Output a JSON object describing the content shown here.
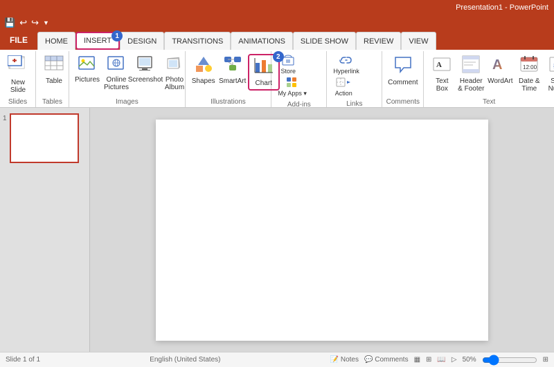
{
  "titleBar": {
    "text": "Presentation1 - PowerPoint"
  },
  "quickAccess": {
    "icons": [
      "💾",
      "↩",
      "↪"
    ]
  },
  "tabs": [
    {
      "id": "file",
      "label": "FILE",
      "type": "file"
    },
    {
      "id": "home",
      "label": "HOME"
    },
    {
      "id": "insert",
      "label": "INSERT",
      "active": true,
      "highlighted": true
    },
    {
      "id": "design",
      "label": "DESIGN"
    },
    {
      "id": "transitions",
      "label": "TRANSITIONS"
    },
    {
      "id": "animations",
      "label": "ANIMATIONS"
    },
    {
      "id": "slideshow",
      "label": "SLIDE SHOW"
    },
    {
      "id": "review",
      "label": "REVIEW"
    },
    {
      "id": "view",
      "label": "VIEW"
    }
  ],
  "ribbon": {
    "groups": [
      {
        "id": "slides",
        "label": "Slides",
        "buttons": [
          {
            "id": "new-slide",
            "label": "New\nSlide",
            "icon": "slide",
            "size": "large"
          }
        ]
      },
      {
        "id": "tables",
        "label": "Tables",
        "buttons": [
          {
            "id": "table",
            "label": "Table",
            "icon": "table",
            "size": "large"
          }
        ]
      },
      {
        "id": "images",
        "label": "Images",
        "buttons": [
          {
            "id": "pictures",
            "label": "Pictures",
            "icon": "picture"
          },
          {
            "id": "online-pictures",
            "label": "Online\nPictures",
            "icon": "online-pic"
          },
          {
            "id": "screenshot",
            "label": "Screenshot",
            "icon": "screenshot"
          },
          {
            "id": "photo-album",
            "label": "Photo\nAlbum",
            "icon": "album"
          }
        ]
      },
      {
        "id": "illustrations",
        "label": "Illustrations",
        "buttons": [
          {
            "id": "shapes",
            "label": "Shapes",
            "icon": "shapes"
          },
          {
            "id": "smartart",
            "label": "SmartArt",
            "icon": "smartart"
          },
          {
            "id": "chart",
            "label": "Chart",
            "icon": "chart",
            "highlighted": true
          }
        ]
      },
      {
        "id": "addins",
        "label": "Add-ins",
        "buttons": [
          {
            "id": "store",
            "label": "Store",
            "icon": "store"
          },
          {
            "id": "myapps",
            "label": "My Apps",
            "icon": "apps"
          }
        ]
      },
      {
        "id": "links",
        "label": "Links",
        "buttons": [
          {
            "id": "hyperlink",
            "label": "Hyperlink",
            "icon": "hyperlink"
          },
          {
            "id": "action",
            "label": "Action",
            "icon": "action"
          }
        ]
      },
      {
        "id": "comments",
        "label": "Comments",
        "buttons": [
          {
            "id": "comment",
            "label": "Comment",
            "icon": "comment"
          }
        ]
      },
      {
        "id": "text",
        "label": "Text",
        "buttons": [
          {
            "id": "textbox",
            "label": "Text\nBox",
            "icon": "textbox"
          },
          {
            "id": "header-footer",
            "label": "Header\n& Footer",
            "icon": "headerfooter"
          },
          {
            "id": "wordart",
            "label": "WordArt",
            "icon": "wordart"
          },
          {
            "id": "datetime",
            "label": "Date &\nTime",
            "icon": "datetime"
          },
          {
            "id": "slidenumber",
            "label": "Slide\nNum...",
            "icon": "slidenum"
          }
        ]
      }
    ]
  },
  "slide": {
    "number": "1"
  },
  "statusBar": {
    "left": "Slide 1 of 1",
    "center": "English (United States)",
    "right": "Notes  Comments"
  },
  "badges": {
    "insert": "1",
    "chart": "2"
  }
}
